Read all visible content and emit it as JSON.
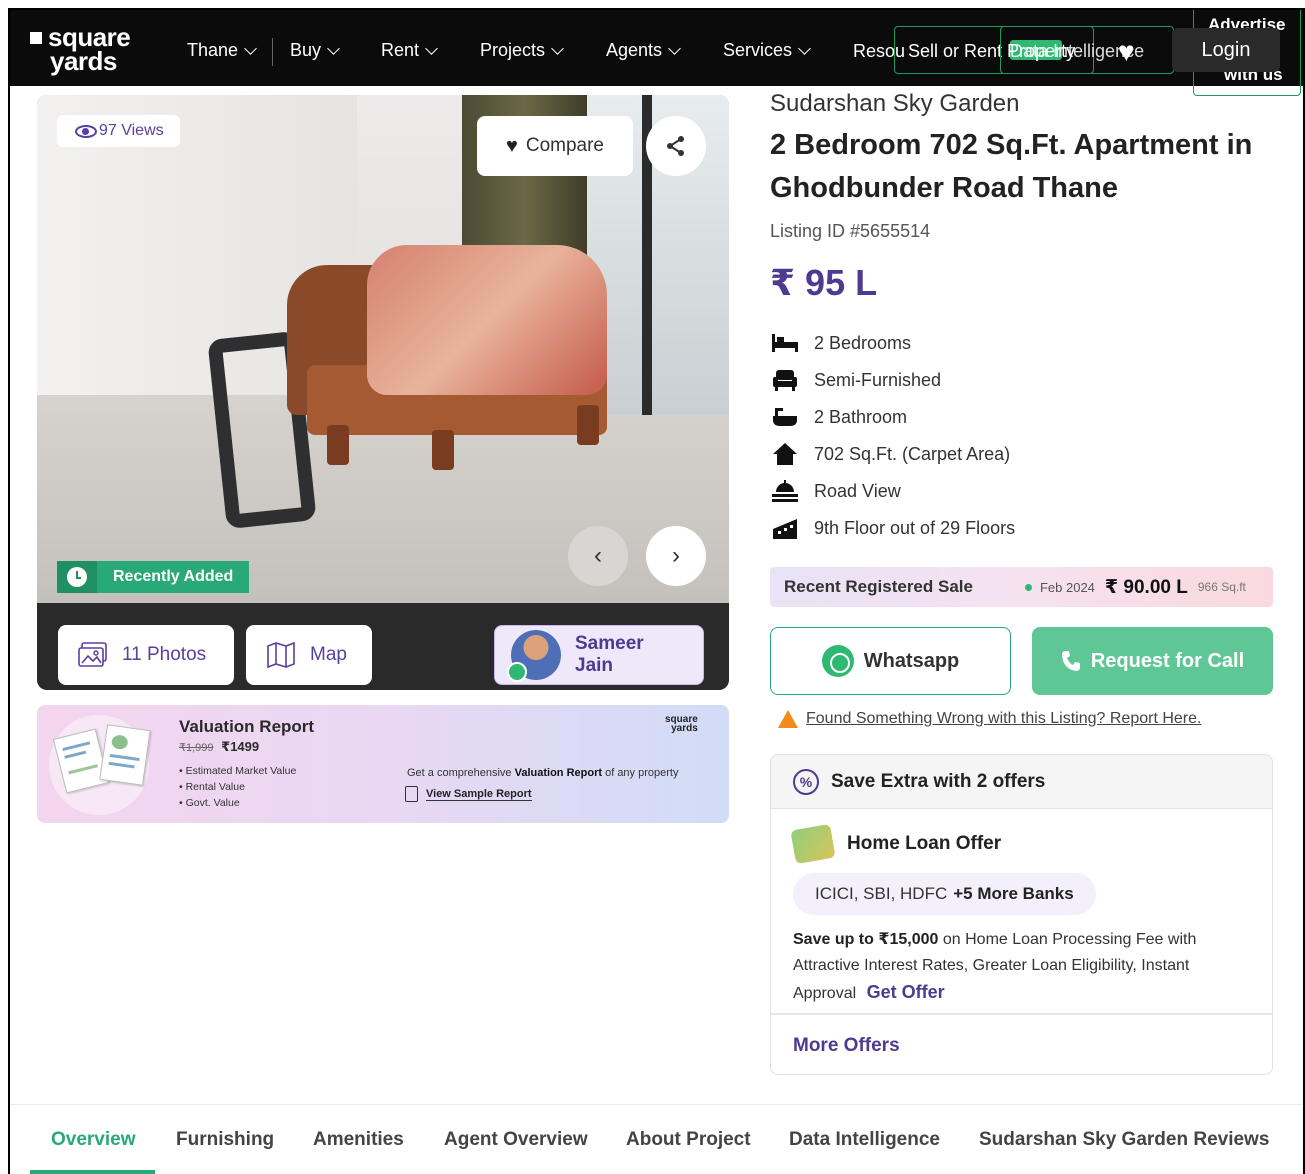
{
  "nav": {
    "logo_line1": "square",
    "logo_line2": "yards",
    "items": [
      {
        "label": "Thane"
      },
      {
        "label": "Buy"
      },
      {
        "label": "Rent"
      },
      {
        "label": "Projects"
      },
      {
        "label": "Agents"
      },
      {
        "label": "Services"
      }
    ],
    "resources": "Resou",
    "sell_rent": "Sell or Rent Property",
    "intelligence": "Data Intelligence",
    "login": "Login",
    "advertise_line1": "Advertise",
    "advertise_line2": "with us"
  },
  "gallery": {
    "views": "97 Views",
    "compare": "Compare",
    "recently_added": "Recently Added",
    "photos": "11 Photos",
    "map": "Map",
    "agent_name": "Sameer Jain"
  },
  "valuation": {
    "title": "Valuation Report",
    "old_price": "₹1,999",
    "price": "₹1499",
    "bullets": [
      "Estimated Market Value",
      "Rental Value",
      "Govt. Value"
    ],
    "logo_line1": "square",
    "logo_line2": "yards",
    "desc_prefix": "Get a comprehensive ",
    "desc_bold": "Valuation Report",
    "desc_suffix": " of any property",
    "sample": "View Sample Report"
  },
  "listing": {
    "project": "Sudarshan Sky Garden",
    "title": "2 Bedroom 702 Sq.Ft. Apartment in Ghodbunder Road Thane",
    "listing_id": "Listing ID #5655514",
    "price": "₹ 95 L",
    "features": [
      {
        "icon": "bed-icon",
        "label": "2 Bedrooms"
      },
      {
        "icon": "sofa-icon",
        "label": "Semi-Furnished"
      },
      {
        "icon": "bathtub-icon",
        "label": "2 Bathroom"
      },
      {
        "icon": "home-icon",
        "label": "702 Sq.Ft. (Carpet Area)"
      },
      {
        "icon": "view-icon",
        "label": "Road View"
      },
      {
        "icon": "building-icon",
        "label": "9th Floor out of 29 Floors"
      }
    ]
  },
  "recent_sale": {
    "label": "Recent Registered Sale",
    "date": "Feb 2024",
    "price": "₹ 90.00 L",
    "area": "966 Sq.ft"
  },
  "actions": {
    "whatsapp": "Whatsapp",
    "request_call": "Request for Call",
    "report": "Found Something Wrong with this Listing? Report Here."
  },
  "offers": {
    "heading": "Save Extra with 2 offers",
    "home_loan": "Home Loan Offer",
    "banks": "ICICI, SBI, HDFC",
    "banks_more": "+5 More Banks",
    "save_bold": "Save up to ₹15,000",
    "save_text": " on Home Loan Processing Fee with Attractive Interest Rates, Greater Loan Eligibility, Instant Approval",
    "get_offer": "Get Offer",
    "more_offers": "More Offers"
  },
  "tabs": [
    "Overview",
    "Furnishing",
    "Amenities",
    "Agent Overview",
    "About Project",
    "Data Intelligence",
    "Sudarshan Sky Garden Reviews"
  ],
  "colors": {
    "accent_purple": "#4e3a91",
    "accent_green": "#2aa978",
    "nav_bg": "#0b0b0b"
  }
}
